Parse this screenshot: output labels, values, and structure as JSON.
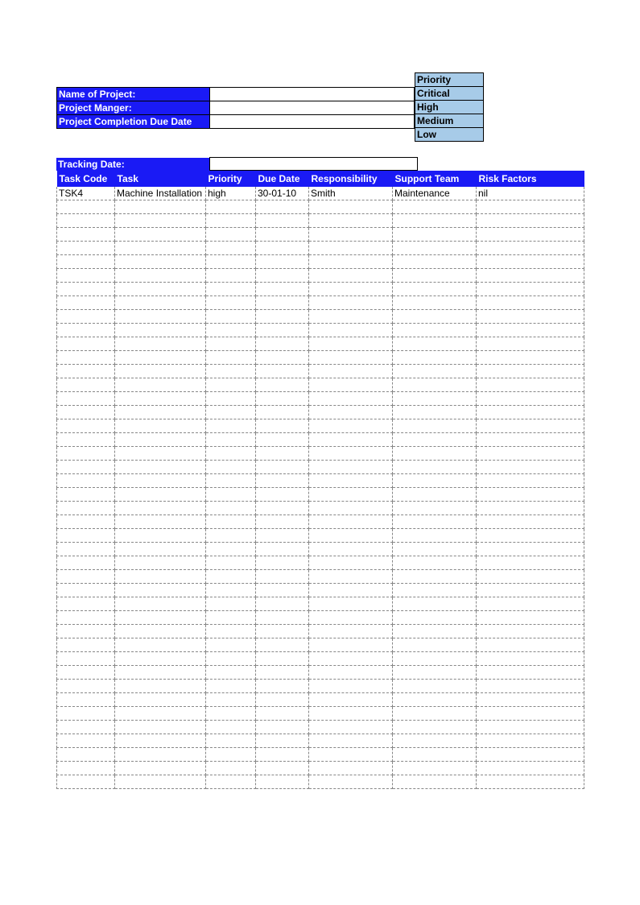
{
  "info": {
    "name_label": "Name of Project:",
    "name_value": "",
    "manager_label": "Project Manger:",
    "manager_value": "",
    "completion_label": "Project Completion Due Date",
    "completion_value": ""
  },
  "priority_legend": {
    "header": "Priority",
    "levels": [
      "Critical",
      "High",
      "Medium",
      "Low"
    ]
  },
  "tracking": {
    "label": "Tracking Date:",
    "value": ""
  },
  "columns": {
    "task_code": "Task Code",
    "task": "Task",
    "priority": "Priority",
    "due_date": "Due Date",
    "responsibility": "Responsibility",
    "support_team": "Support Team",
    "risk_factors": "Risk Factors"
  },
  "rows": [
    {
      "task_code": "TSK4",
      "task": "Machine Installation",
      "priority": "high",
      "due_date": "30-01-10",
      "responsibility": "Smith",
      "support_team": "Maintenance",
      "risk_factors": "nil"
    }
  ],
  "empty_row_count": 43
}
